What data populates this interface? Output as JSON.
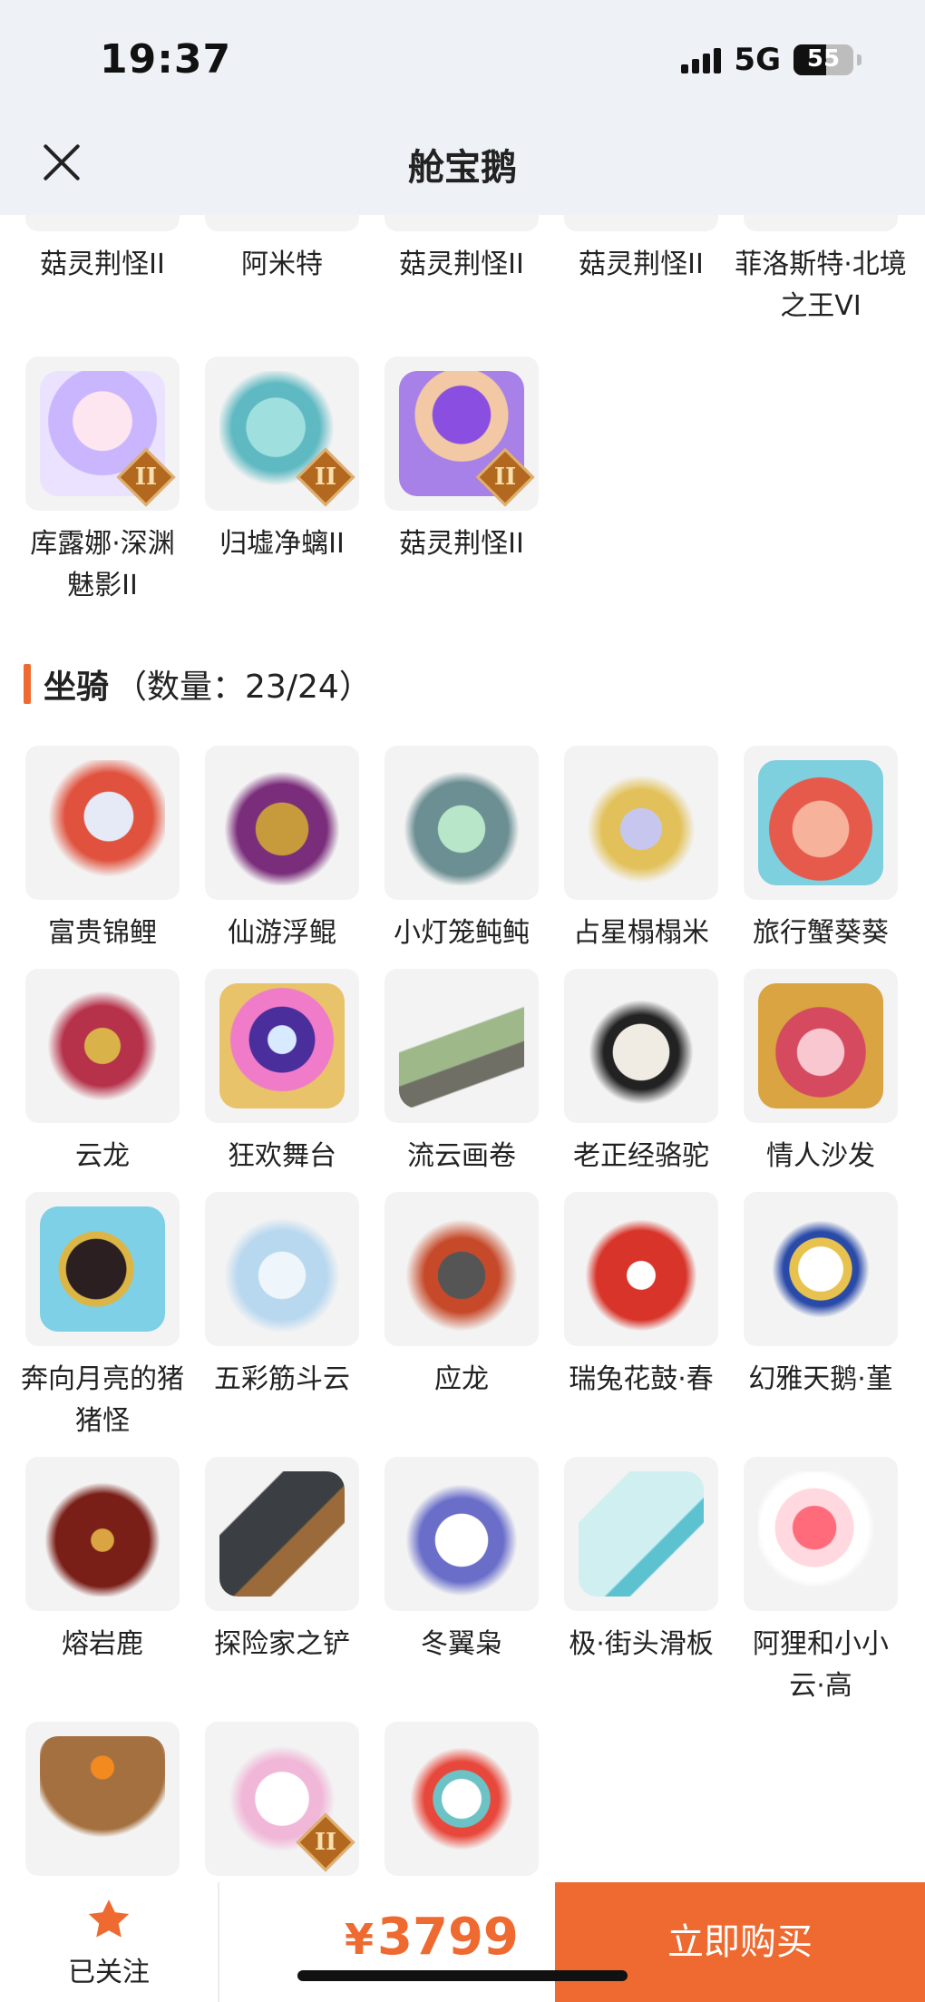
{
  "status": {
    "time": "19:37",
    "network": "5G",
    "battery": "55"
  },
  "header": {
    "title": "舱宝鹅"
  },
  "top_grid": {
    "cut_row": [
      "菇灵荆怪II",
      "阿米特",
      "菇灵荆怪II",
      "菇灵荆怪II",
      "菲洛斯特·北境之王VI"
    ],
    "row": [
      {
        "label": "库露娜·深渊魅影II",
        "badge": "II"
      },
      {
        "label": "归墟净螭II",
        "badge": "II"
      },
      {
        "label": "菇灵荆怪II",
        "badge": "II"
      }
    ]
  },
  "mounts": {
    "title": "坐骑",
    "count": "（数量：23/24）",
    "items": [
      "富贵锦鲤",
      "仙游浮鲲",
      "小灯笼鲀鲀",
      "占星榻榻米",
      "旅行蟹葵葵",
      "云龙",
      "狂欢舞台",
      "流云画卷",
      "老正经骆驼",
      "情人沙发",
      "奔向月亮的猪猪怪",
      "五彩筋斗云",
      "应龙",
      "瑞兔花鼓·春",
      "幻雅天鹅·堇",
      "熔岩鹿",
      "探险家之铲",
      "冬翼枭",
      "极·街头滑板",
      "阿狸和小小云·高",
      "",
      "",
      ""
    ],
    "badge": "II"
  },
  "bottom": {
    "follow_label": "已关注",
    "currency": "¥",
    "price": "3799",
    "buy_label": "立即购买"
  },
  "colors": {
    "accent": "#ee6a30",
    "header_bg": "#eef1f5",
    "thumb_bg": "#f3f3f3"
  }
}
